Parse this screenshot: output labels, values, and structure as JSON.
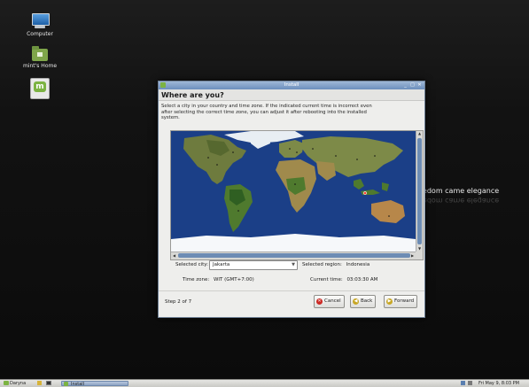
{
  "desktop": {
    "icons": [
      {
        "label": "Computer",
        "icon": "computer-icon"
      },
      {
        "label": "mint's Home",
        "icon": "home-folder-icon"
      },
      {
        "label": "",
        "icon": "mint-installer-icon"
      }
    ],
    "slogan": "eedom came elegance"
  },
  "window": {
    "title": "Install",
    "controls": {
      "minimize": "_",
      "maximize": "□",
      "close": "✕"
    },
    "heading": "Where are you?",
    "description": "Select a city in your country and time zone. If the indicated current time is incorrect even after selecting the correct time zone, you can adjust it after rebooting into the installed system.",
    "form": {
      "selected_city_label": "Selected city:",
      "selected_city_value": "Jakarta",
      "selected_region_label": "Selected region:",
      "selected_region_value": "Indonesia",
      "time_zone_label": "Time zone:",
      "time_zone_value": "WIT (GMT+7:00)",
      "current_time_label": "Current time:",
      "current_time_value": "03:03:30 AM"
    },
    "footer": {
      "step": "Step 2 of 7",
      "cancel": "Cancel",
      "back": "Back",
      "forward": "Forward"
    }
  },
  "taskbar": {
    "menu": "Daryna",
    "task": "Install",
    "clock": "Fri May 9, 8:03 PM"
  },
  "colors": {
    "ocean": "#1b3f87",
    "land": "#6e7b3e",
    "ice": "#ffffff",
    "accent": "#6d8cb4"
  }
}
